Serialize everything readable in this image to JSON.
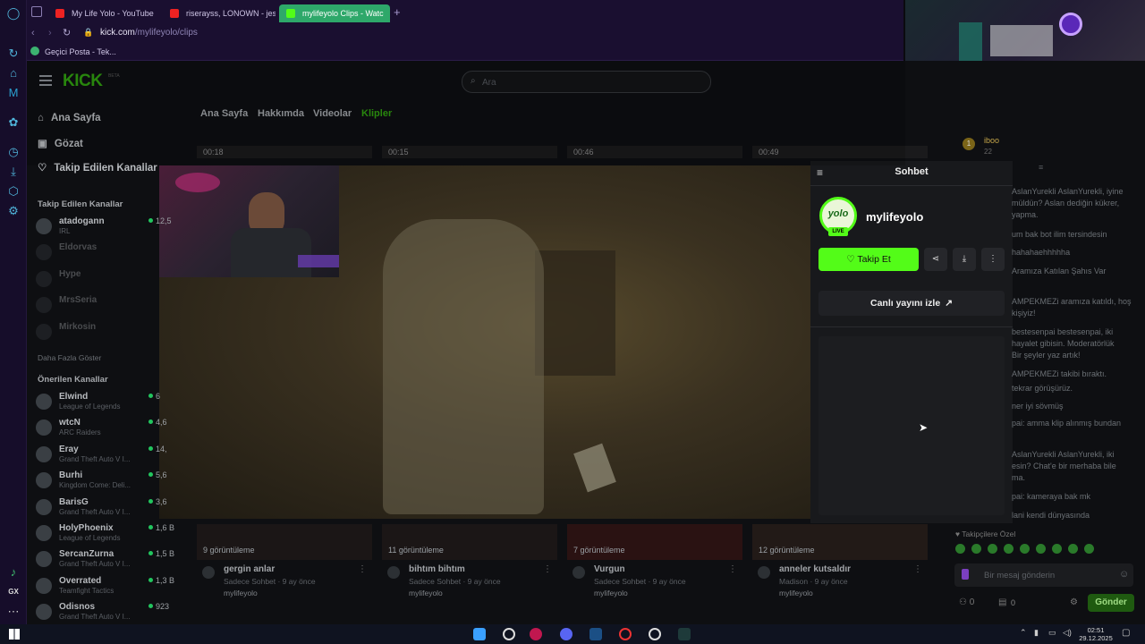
{
  "browser": {
    "tabs": [
      {
        "label": "My Life Yolo - YouTube",
        "icon": "youtube-icon"
      },
      {
        "label": "riserayss, LONOWN - jess",
        "icon": "youtube-icon"
      },
      {
        "label": "mylifeyolo Clips - Watc",
        "icon": "kick-icon"
      }
    ],
    "url_base": "kick.com",
    "url_path": "/mylifeyolo/clips",
    "bookmark": "Geçici Posta - Tek..."
  },
  "kick": {
    "logo": "KICK",
    "logo_badge": "BETA",
    "search_placeholder": "Ara",
    "nav": [
      "Ana Sayfa",
      "Gözat",
      "Takip Edilen Kanallar"
    ],
    "followed_title": "Takip Edilen Kanallar",
    "followed": [
      {
        "name": "atadogann",
        "sub": "IRL",
        "viewers": "12,5"
      },
      {
        "name": "Eldorvas",
        "sub": "",
        "viewers": ""
      },
      {
        "name": "Hype",
        "sub": "",
        "viewers": ""
      },
      {
        "name": "MrsSeria",
        "sub": "",
        "viewers": ""
      },
      {
        "name": "Mirkosin",
        "sub": "",
        "viewers": ""
      }
    ],
    "show_more": "Daha Fazla Göster",
    "recommended_title": "Önerilen Kanallar",
    "recommended": [
      {
        "name": "Elwind",
        "sub": "League of Legends",
        "viewers": "6"
      },
      {
        "name": "wtcN",
        "sub": "ARC Raiders",
        "viewers": "4,6"
      },
      {
        "name": "Eray",
        "sub": "Grand Theft Auto V I...",
        "viewers": "14,"
      },
      {
        "name": "Burhi",
        "sub": "Kingdom Come: Deli...",
        "viewers": "5,6"
      },
      {
        "name": "BarisG",
        "sub": "Grand Theft Auto V I...",
        "viewers": "3,6"
      },
      {
        "name": "HolyPhoenix",
        "sub": "League of Legends",
        "viewers": "1,6 B"
      },
      {
        "name": "SercanZurna",
        "sub": "Grand Theft Auto V I...",
        "viewers": "1,5 B"
      },
      {
        "name": "Overrated",
        "sub": "Teamfight Tactics",
        "viewers": "1,3 B"
      },
      {
        "name": "Odisnos",
        "sub": "Grand Theft Auto V I...",
        "viewers": "923"
      }
    ],
    "channel_tabs": [
      "Ana Sayfa",
      "Hakkımda",
      "Videolar",
      "Klipler"
    ],
    "top_durations": [
      "00:18",
      "00:15",
      "00:46",
      "00:49"
    ],
    "clips": [
      {
        "views": "9 görüntüleme",
        "title": "gergin anlar",
        "sub": "Sadece Sohbet · 9 ay önce",
        "channel": "mylifeyolo"
      },
      {
        "views": "11 görüntüleme",
        "title": "bihtım bihtım",
        "sub": "Sadece Sohbet · 9 ay önce",
        "channel": "mylifeyolo"
      },
      {
        "views": "7 görüntüleme",
        "title": "Vurgun",
        "sub": "Sadece Sohbet · 9 ay önce",
        "channel": "mylifeyolo"
      },
      {
        "views": "12 görüntüleme",
        "title": "anneler kutsaldır",
        "sub": "Madison · 9 ay önce",
        "channel": "mylifeyolo"
      }
    ],
    "chat_lines": [
      "AslanYurekli AslanYurekli, iyine",
      "müldün? Aslan dediğin kükrer,",
      "yapma.",
      "um bak bot ilim tersindesin",
      "hahahaehhhhha",
      "Aramıza Katılan Şahıs Var",
      "AMPEKMEZi aramıza katıldı, hoş",
      "kişiyiz!",
      "bestesenpai bestesenpai, iki",
      "hayalet gibisin. Moderatörlük",
      "Bir şeyler yaz artık!",
      "AMPEKMEZi takibi bıraktı.",
      "tekrar görüşürüz.",
      "ner iyi sövmüş",
      "pai: amma klip alınmış bundan",
      "AslanYurekli AslanYurekli, iki",
      "esin? Chat'e bir merhaba bile",
      "ma.",
      "pai: kameraya bak mk",
      "lani kendi dünyasında"
    ],
    "chat_placeholder": "Bir mesaj gönderin",
    "send": "Gönder",
    "sub_label": "Takipçilere Özel",
    "points": "0",
    "chat_user": "iboo",
    "chat_user_count": "22"
  },
  "modal": {
    "title": "Sohbet",
    "channel": "mylifeyolo",
    "live_badge": "LIVE",
    "avatar_text": "yolo",
    "follow": "Takip Et",
    "watch_live": "Canlı yayını izle"
  },
  "overlay": {
    "discord_name": "mylifeyolo"
  },
  "taskbar": {
    "time": "02:51",
    "date": "29.12.2025"
  },
  "colors": {
    "kick_green": "#53fc18",
    "discord": "#5865f2"
  }
}
